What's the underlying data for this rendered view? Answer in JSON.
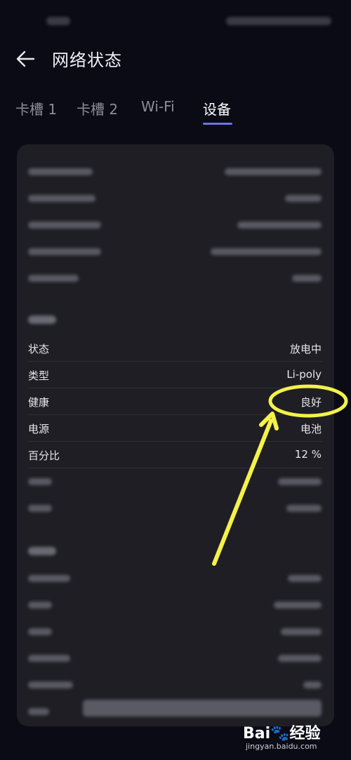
{
  "header": {
    "title": "网络状态"
  },
  "tabs": [
    {
      "label": "卡槽 1"
    },
    {
      "label": "卡槽 2"
    },
    {
      "label": "Wi-Fi"
    },
    {
      "label": "设备"
    }
  ],
  "battery": {
    "rows": [
      {
        "label": "状态",
        "value": "放电中"
      },
      {
        "label": "类型",
        "value": "Li-poly"
      },
      {
        "label": "健康",
        "value": "良好"
      },
      {
        "label": "电源",
        "value": "电池"
      },
      {
        "label": "百分比",
        "value": "12 %"
      }
    ]
  },
  "annotation": {
    "color": "#f4f14a"
  },
  "watermark": {
    "logo": "Bai🐾经验",
    "url": "jingyan.baidu.com"
  },
  "colors": {
    "accent": "#6b74e6",
    "card": "#1e1e24",
    "background": "#0b0b16"
  }
}
